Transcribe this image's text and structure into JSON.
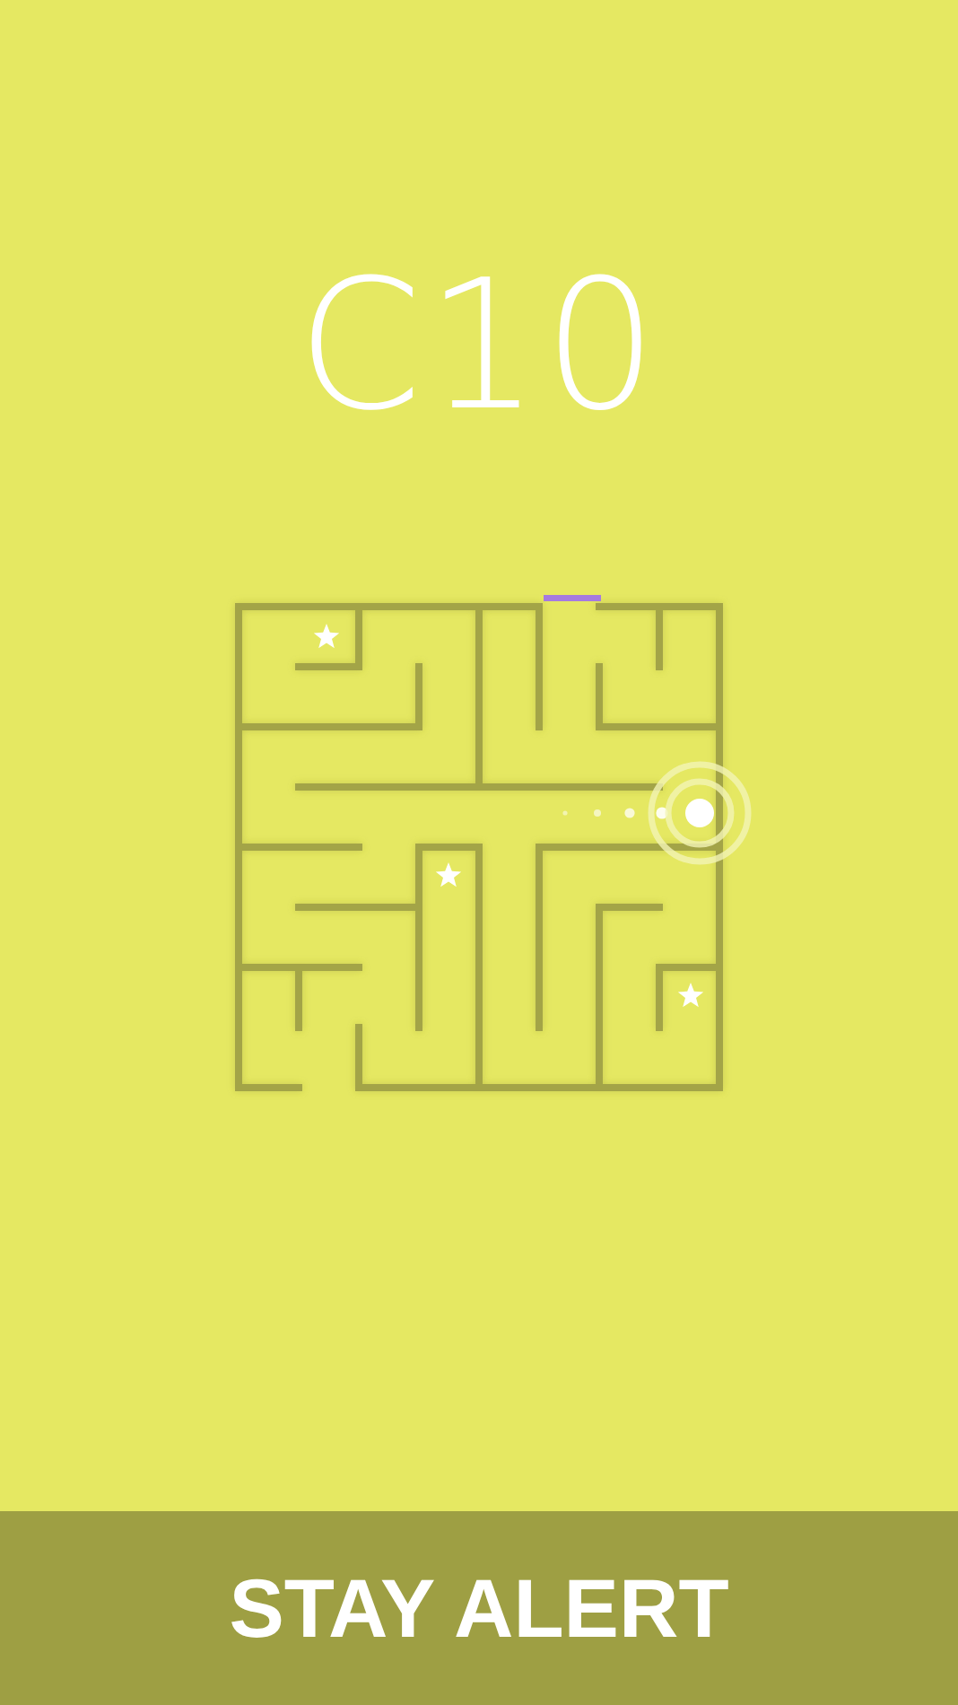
{
  "level_title": "C10",
  "banner": {
    "text": "STAY ALERT"
  }
}
